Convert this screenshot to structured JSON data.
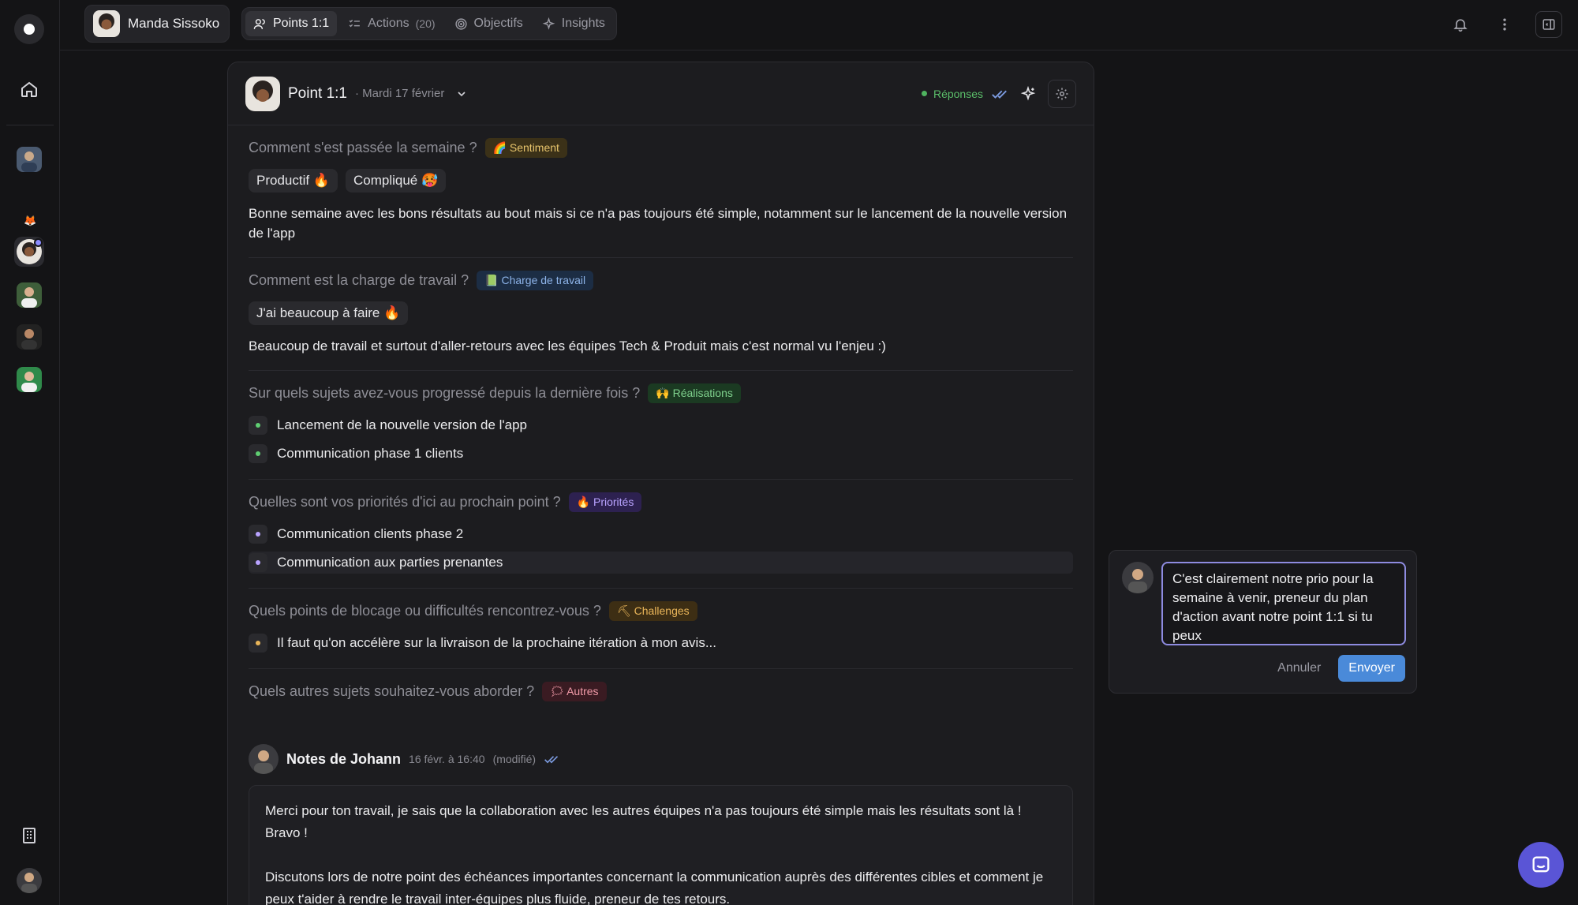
{
  "topbar": {
    "user_name": "Manda Sissoko",
    "tabs": [
      {
        "label": "Points 1:1",
        "count": "",
        "icon": "people-icon",
        "active": true
      },
      {
        "label": "Actions",
        "count": "(20)",
        "icon": "checklist-icon",
        "active": false
      },
      {
        "label": "Objectifs",
        "count": "",
        "icon": "target-icon",
        "active": false
      },
      {
        "label": "Insights",
        "count": "",
        "icon": "sparkle-icon",
        "active": false
      }
    ]
  },
  "card": {
    "title": "Point 1:1",
    "date": "· Mardi 17 février",
    "responses_label": "Réponses"
  },
  "sections": [
    {
      "question": "Comment s'est passée la semaine ?",
      "badge": "🌈 Sentiment",
      "chips": [
        "Productif 🔥",
        "Compliqué 🥵"
      ],
      "answer": "Bonne semaine avec les bons résultats au bout mais si ce n'a pas toujours été simple, notamment sur le lancement de la nouvelle version de l'app"
    },
    {
      "question": "Comment est la charge de travail ?",
      "badge": "📗 Charge de travail",
      "chips": [
        "J'ai beaucoup à faire 🔥"
      ],
      "answer": "Beaucoup de travail et surtout d'aller-retours avec les équipes Tech & Produit mais c'est normal vu l'enjeu :)"
    },
    {
      "question": "Sur quels sujets avez-vous progressé depuis la dernière fois ?",
      "badge": "🙌 Réalisations",
      "items": [
        "Lancement de la nouvelle version de l'app",
        "Communication phase 1 clients"
      ]
    },
    {
      "question": "Quelles sont vos priorités d'ici au prochain point ?",
      "badge": "🔥 Priorités",
      "items": [
        "Communication clients phase 2",
        "Communication aux parties prenantes"
      ]
    },
    {
      "question": "Quels points de blocage ou difficultés rencontrez-vous ?",
      "badge": "⛏ Challenges",
      "items": [
        "Il faut qu'on accélère sur la livraison de la prochaine itération à mon avis..."
      ]
    },
    {
      "question": "Quels autres sujets souhaitez-vous aborder ?",
      "badge": "🗯 Autres"
    }
  ],
  "notes": {
    "author": "Notes de Johann",
    "timestamp": "16 févr. à 16:40",
    "modified": "(modifié)",
    "paragraphs": [
      "Merci pour ton travail, je sais que la collaboration avec les autres équipes n'a pas toujours été simple mais les résultats sont là ! Bravo !",
      "Discutons lors de notre point des échéances importantes concernant la communication auprès des différentes cibles et comment je peux t'aider à rendre le travail inter-équipes plus fluide, preneur de tes retours."
    ]
  },
  "comment": {
    "text": "C'est clairement notre prio pour la semaine à venir, preneur du plan d'action avant notre point 1:1 si tu peux",
    "cancel": "Annuler",
    "send": "Envoyer"
  },
  "colors": {
    "accent": "#4a8ad9",
    "focus_ring": "#8e8be0",
    "success": "#4fb35f"
  }
}
